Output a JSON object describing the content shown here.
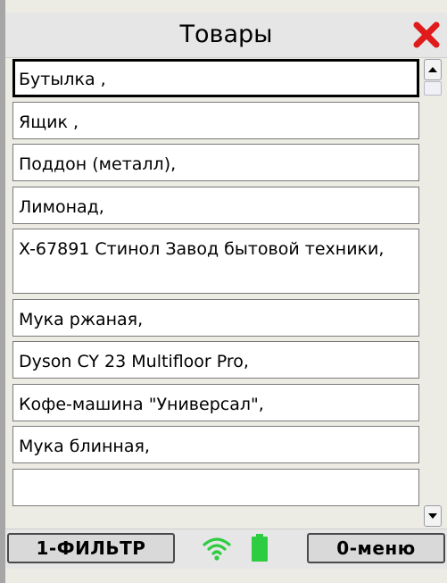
{
  "window": {
    "title": "Товары"
  },
  "items": [
    "Бутылка ,",
    "Ящик ,",
    "Поддон (металл),",
    "Лимонад,",
    "X-67891 Стинол Завод бытовой техники,",
    "Мука ржаная,",
    "Dyson CY 23 Multifloor Pro,",
    "Кофе-машина \"Универсал\",",
    "Мука блинная,"
  ],
  "selected_index": 0,
  "footer": {
    "filter_label": "1-ФИЛЬТР",
    "menu_label": "0-меню"
  },
  "icons": {
    "close": "close-icon",
    "scroll_up": "arrow-up-icon",
    "scroll_down": "arrow-down-icon",
    "wifi": "wifi-icon",
    "battery": "battery-icon"
  },
  "colors": {
    "close_red": "#e01b1b",
    "status_green": "#2ecc40",
    "background": "#ecece4"
  }
}
